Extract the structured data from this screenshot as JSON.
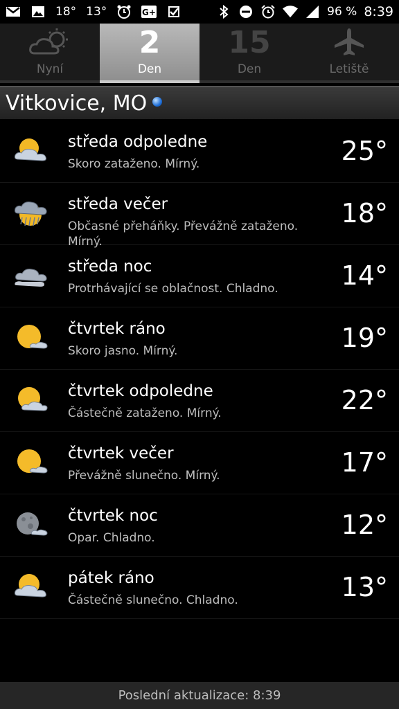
{
  "status_bar": {
    "temp1": "18°",
    "temp2": "13°",
    "battery": "96 %",
    "time": "8:39",
    "left_icons": [
      "gmail-icon",
      "photo-icon",
      "alarm-clock-icon",
      "google-plus-icon",
      "tasks-icon"
    ],
    "right_icons": [
      "bluetooth-icon",
      "do-not-disturb-icon",
      "alarm-icon",
      "wifi-icon",
      "signal-icon"
    ]
  },
  "tabs": [
    {
      "big": "",
      "label": "Nyní",
      "icon": "cloud-sun-icon",
      "active": false
    },
    {
      "big": "2",
      "label": "Den",
      "active": true
    },
    {
      "big": "15",
      "label": "Den",
      "active": false
    },
    {
      "big": "",
      "label": "Letiště",
      "icon": "airplane-icon",
      "active": false
    }
  ],
  "location": {
    "title": "Vitkovice, MO"
  },
  "forecast": [
    {
      "period": "středa odpoledne",
      "desc": "Skoro zataženo. Mírný.",
      "temp": "25°",
      "icon": "partly-cloudy-icon"
    },
    {
      "period": "středa večer",
      "desc": "Občasné přeháňky. Převážně zataženo. Mírný.",
      "temp": "18°",
      "icon": "showers-icon"
    },
    {
      "period": "středa noc",
      "desc": "Protrhávající se oblačnost. Chladno.",
      "temp": "14°",
      "icon": "cloudy-night-icon"
    },
    {
      "period": "čtvrtek ráno",
      "desc": "Skoro jasno. Mírný.",
      "temp": "19°",
      "icon": "mostly-sunny-icon"
    },
    {
      "period": "čtvrtek odpoledne",
      "desc": "Částečně zataženo. Mírný.",
      "temp": "22°",
      "icon": "partly-cloudy-icon"
    },
    {
      "period": "čtvrtek večer",
      "desc": "Převážně slunečno. Mírný.",
      "temp": "17°",
      "icon": "mostly-sunny-icon"
    },
    {
      "period": "čtvrtek noc",
      "desc": "Opar. Chladno.",
      "temp": "12°",
      "icon": "moon-haze-icon"
    },
    {
      "period": "pátek ráno",
      "desc": "Částečně slunečno. Chladno.",
      "temp": "13°",
      "icon": "partly-sunny-icon"
    }
  ],
  "footer": {
    "text": "Poslední aktualizace: 8:39"
  }
}
